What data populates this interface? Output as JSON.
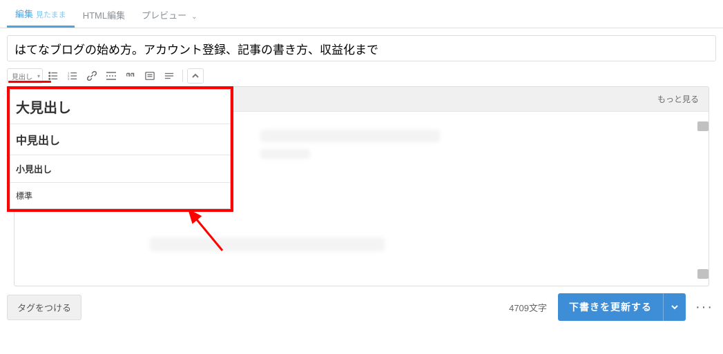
{
  "tabs": {
    "edit": "編集",
    "edit_sub": "見たまま",
    "html": "HTML編集",
    "preview": "プレビュー"
  },
  "title": "はてなブログの始め方。アカウント登録、記事の書き方、収益化まで",
  "toolbar": {
    "heading_label": "見出し"
  },
  "heading_options": {
    "h1": "大見出し",
    "h2": "中見出し",
    "h3": "小見出し",
    "p": "標準"
  },
  "more_link": "もっと見る",
  "footer": {
    "tag_button": "タグをつける",
    "char_count": "4709文字",
    "save": "下書きを更新する"
  }
}
